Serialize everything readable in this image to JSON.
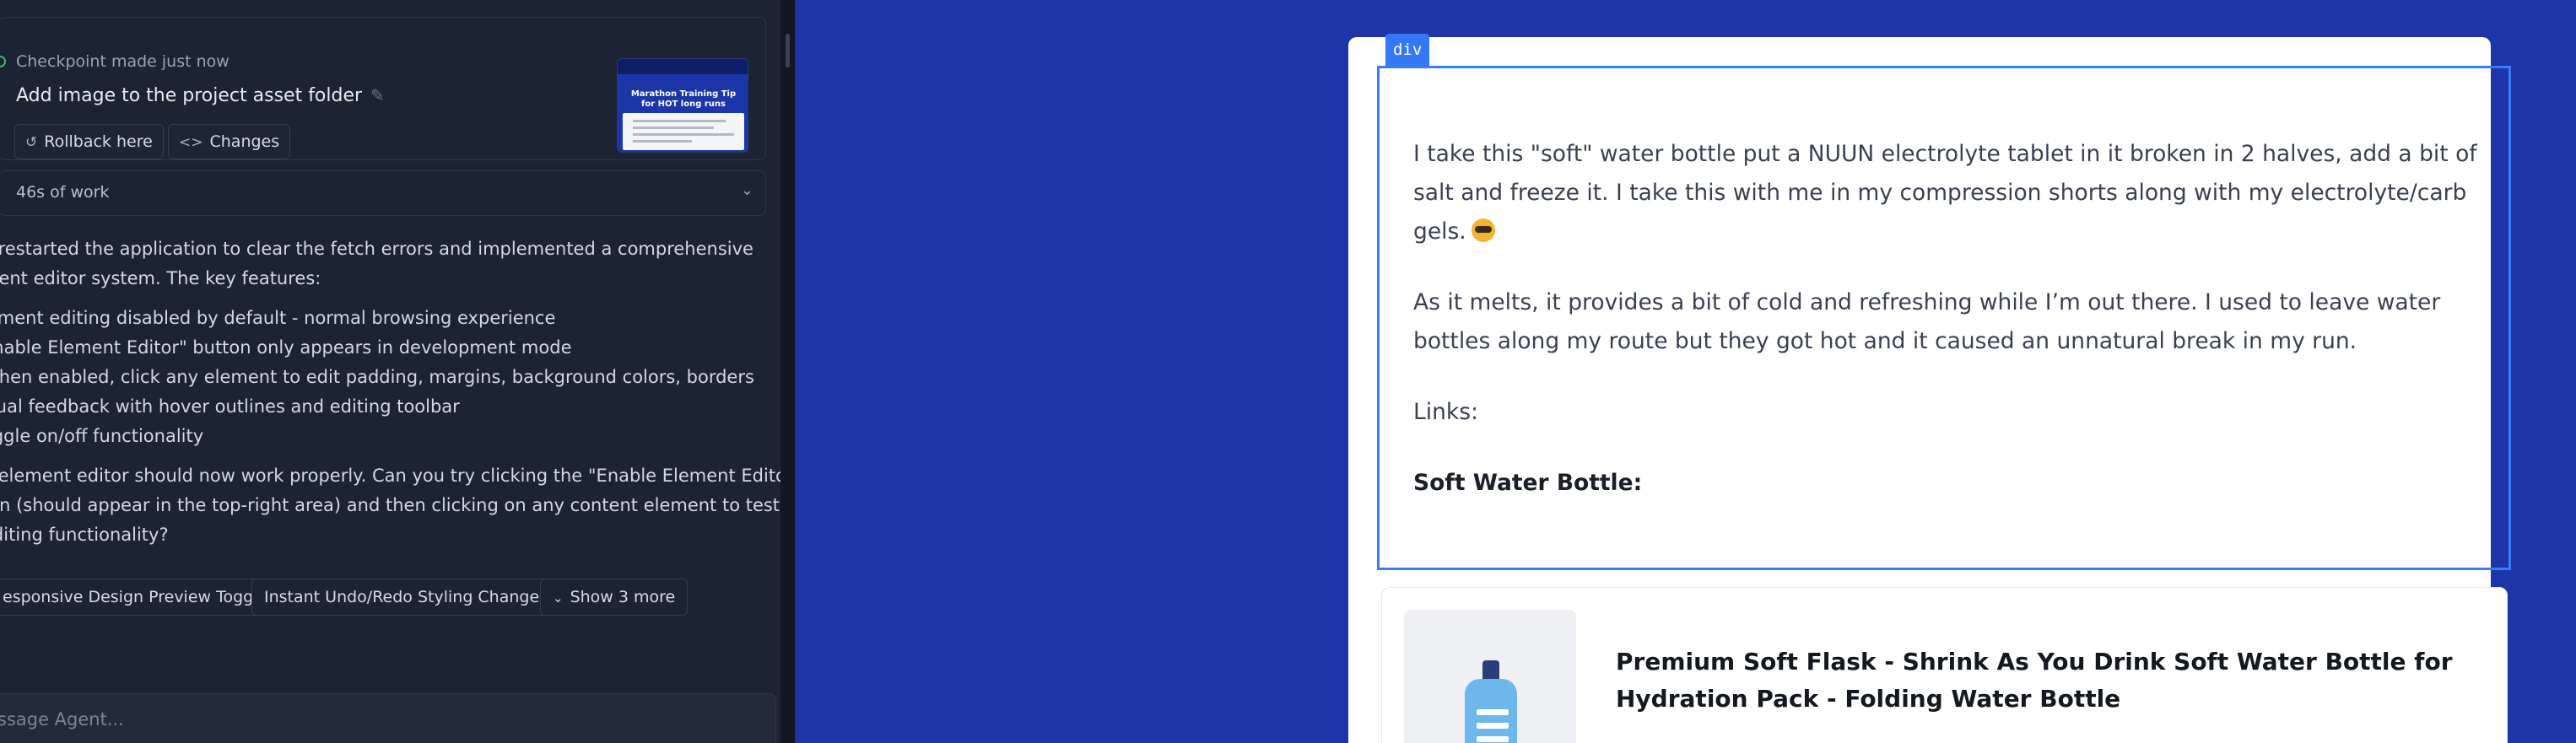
{
  "checkpoint": {
    "meta": "Checkpoint made just now",
    "title": "Add image to the project asset folder",
    "rollback_label": "Rollback here",
    "changes_label": "Changes",
    "thumbnail_title": "Marathon Training Tip for HOT long runs"
  },
  "work": {
    "label": "46s of work"
  },
  "message": {
    "intro_line1": "e restarted the application to clear the fetch errors and implemented a comprehensive",
    "intro_line2": "ment editor system. The key features:",
    "features": [
      "lement editing disabled by default - normal browsing experience",
      "Enable Element Editor\" button only appears in development mode",
      "When enabled, click any element to edit padding, margins, background colors, borders",
      "isual feedback with hover outlines and editing toolbar",
      "oggle on/off functionality"
    ],
    "outro_line1": "e element editor should now work properly. Can you try clicking the \"Enable Element Editor\"",
    "outro_line2": "ton (should appear in the top-right area) and then clicking on any content element to test",
    "outro_line3": "editing functionality?"
  },
  "suggestions": [
    "esponsive Design Preview Toggle",
    "Instant Undo/Redo Styling Changes",
    "Show 3 more"
  ],
  "input": {
    "placeholder": "ssage Agent..."
  },
  "preview": {
    "selected_tag": "div",
    "paragraph1": "I take this \"soft\" water bottle put a NUUN electrolyte tablet in it broken in 2 halves, add a bit of salt and freeze it. I take this with me in my compression shorts along with my electrolyte/carb gels.",
    "paragraph2": "As it melts, it provides a bit of cold and refreshing while I’m out there. I used to leave water bottles along my route but they got hot and it caused an unnatural break in my run.",
    "links_label": "Links:",
    "soft_bottle_label": "Soft Water Bottle:",
    "product_title": "Premium Soft Flask - Shrink As You Drink Soft Water Bottle for Hydration Pack - Folding Water Bottle"
  },
  "colors": {
    "panel_bg": "#1c2333",
    "preview_bg": "#1e35aa",
    "selection_blue": "#3b7cf5",
    "checkpoint_green": "#3fb96f"
  }
}
